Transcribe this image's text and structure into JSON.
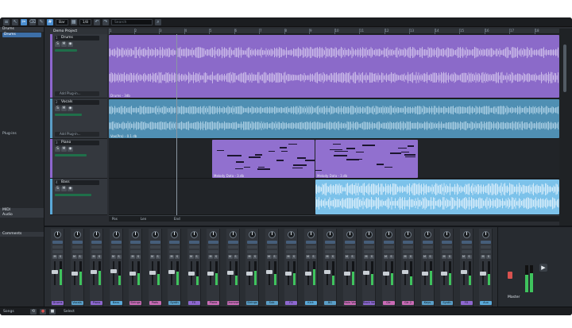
{
  "toolbar": {
    "snap_value": "Bar",
    "grid_value": "1/8",
    "search_placeholder": "Search"
  },
  "inspector": {
    "header": "Drums",
    "sections": [
      "MIDI",
      "Audio",
      "Comments"
    ],
    "input_label": "Plug-ins"
  },
  "song": {
    "title": "Demo Project",
    "ruler": [
      "1",
      "2",
      "3",
      "4",
      "5",
      "6",
      "7",
      "8",
      "9",
      "10",
      "11",
      "12",
      "13",
      "14",
      "15",
      "16",
      "17",
      "18"
    ]
  },
  "tracks": [
    {
      "num": "1",
      "name": "Drums",
      "color": "#8e67cf",
      "plugin_label": "Add Plug-in..."
    },
    {
      "num": "2",
      "name": "Vocals",
      "color": "#5a9ec7",
      "plugin_label": "Add Plug-in..."
    },
    {
      "num": "3",
      "name": "Piano",
      "color": "#8e67cf",
      "plugin_label": ""
    },
    {
      "num": "4",
      "name": "Bass",
      "color": "#5aa9d9",
      "plugin_label": ""
    }
  ],
  "clips": {
    "drums": "Drums - 3db",
    "vocals": "Vox(Pro) - 0.1 db",
    "piano_a": "Melody Data - 3.db",
    "piano_b": "Melody Data - 3.db"
  },
  "arrange_footer": {
    "position_label": "Pos",
    "length_label": "Len",
    "end_label": "End"
  },
  "mixer": {
    "channels": [
      {
        "name": "Drums",
        "color": "#8e67cf",
        "level": 0.65,
        "fader": 0.55
      },
      {
        "name": "Vocals",
        "color": "#5a9ec7",
        "level": 0.55,
        "fader": 0.5
      },
      {
        "name": "Piano",
        "color": "#8e67cf",
        "level": 0.6,
        "fader": 0.55
      },
      {
        "name": "Bass",
        "color": "#5aa9d9",
        "level": 0.4,
        "fader": 0.6
      },
      {
        "name": "Strings",
        "color": "#c96bb5",
        "level": 0.5,
        "fader": 0.5
      },
      {
        "name": "Pads",
        "color": "#c96bb5",
        "level": 0.45,
        "fader": 0.52
      },
      {
        "name": "Synth",
        "color": "#5a9ec7",
        "level": 0.55,
        "fader": 0.55
      },
      {
        "name": "FX",
        "color": "#8e67cf",
        "level": 0.35,
        "fader": 0.48
      },
      {
        "name": "Piano",
        "color": "#c96bb5",
        "level": 0.5,
        "fader": 0.5
      },
      {
        "name": "Choruses",
        "color": "#c96bb5",
        "level": 0.4,
        "fader": 0.52
      },
      {
        "name": "Strings",
        "color": "#5a9ec7",
        "level": 0.6,
        "fader": 0.5
      },
      {
        "name": "Sub",
        "color": "#5a9ec7",
        "level": 0.45,
        "fader": 0.55
      },
      {
        "name": "FX",
        "color": "#8e67cf",
        "level": 0.5,
        "fader": 0.5
      },
      {
        "name": "Kick",
        "color": "#5aa9d9",
        "level": 0.65,
        "fader": 0.48
      },
      {
        "name": "BG",
        "color": "#5a9ec7",
        "level": 0.4,
        "fader": 0.55
      },
      {
        "name": "Main Vox",
        "color": "#c96bb5",
        "level": 0.55,
        "fader": 0.5
      },
      {
        "name": "Back Vox",
        "color": "#8e67cf",
        "level": 0.45,
        "fader": 0.52
      },
      {
        "name": "Gtr",
        "color": "#c96bb5",
        "level": 0.5,
        "fader": 0.5
      },
      {
        "name": "Gtr 2",
        "color": "#c96bb5",
        "level": 0.35,
        "fader": 0.55
      },
      {
        "name": "Keys",
        "color": "#5a9ec7",
        "level": 0.6,
        "fader": 0.5
      },
      {
        "name": "Synth",
        "color": "#5a9ec7",
        "level": 0.5,
        "fader": 0.5
      },
      {
        "name": "FX",
        "color": "#8e67cf",
        "level": 0.4,
        "fader": 0.55
      },
      {
        "name": "Aux",
        "color": "#5aa9d9",
        "level": 0.45,
        "fader": 0.5
      },
      {
        "name": "Master",
        "color": "#8fa0b0",
        "level": 0.75,
        "fader": 0.6
      }
    ],
    "master_label": "Master"
  },
  "transport": {
    "label": "Songs",
    "mode": "Select"
  }
}
